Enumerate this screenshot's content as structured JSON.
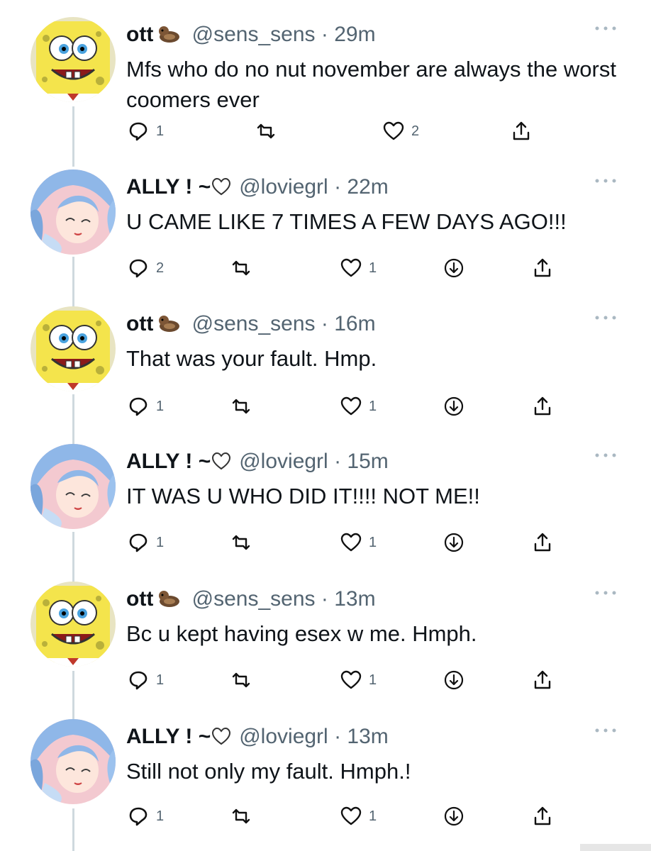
{
  "colors": {
    "text": "#0f1419",
    "muted": "#536471",
    "thread": "#cfd9de"
  },
  "tweets": [
    {
      "author": "ott",
      "emoji": "otter-emoji",
      "handle": "@sens_sens",
      "sep": "·",
      "time": "29m",
      "text": "Mfs who do no nut november are always the worst coomers ever",
      "replies": "1",
      "retweets": "",
      "likes": "2",
      "has_download": false
    },
    {
      "author": "ALLY ! ~",
      "emoji": "heart-outline",
      "handle": "@loviegrl",
      "sep": "·",
      "time": "22m",
      "text": "U CAME LIKE 7 TIMES A FEW DAYS AGO!!!",
      "replies": "2",
      "retweets": "",
      "likes": "1",
      "has_download": true
    },
    {
      "author": "ott",
      "emoji": "otter-emoji",
      "handle": "@sens_sens",
      "sep": "·",
      "time": "16m",
      "text": "That was your fault. Hmp.",
      "replies": "1",
      "retweets": "",
      "likes": "1",
      "has_download": true
    },
    {
      "author": "ALLY ! ~",
      "emoji": "heart-outline",
      "handle": "@loviegrl",
      "sep": "·",
      "time": "15m",
      "text": "IT WAS U WHO DID IT!!!! NOT ME!!",
      "replies": "1",
      "retweets": "",
      "likes": "1",
      "has_download": true
    },
    {
      "author": "ott",
      "emoji": "otter-emoji",
      "handle": "@sens_sens",
      "sep": "·",
      "time": "13m",
      "text": "Bc u kept having esex w me. Hmph.",
      "replies": "1",
      "retweets": "",
      "likes": "1",
      "has_download": true
    },
    {
      "author": "ALLY ! ~",
      "emoji": "heart-outline",
      "handle": "@loviegrl",
      "sep": "·",
      "time": "13m",
      "text": "Still not only my fault. Hmph.!",
      "replies": "1",
      "retweets": "",
      "likes": "1",
      "has_download": true
    }
  ]
}
